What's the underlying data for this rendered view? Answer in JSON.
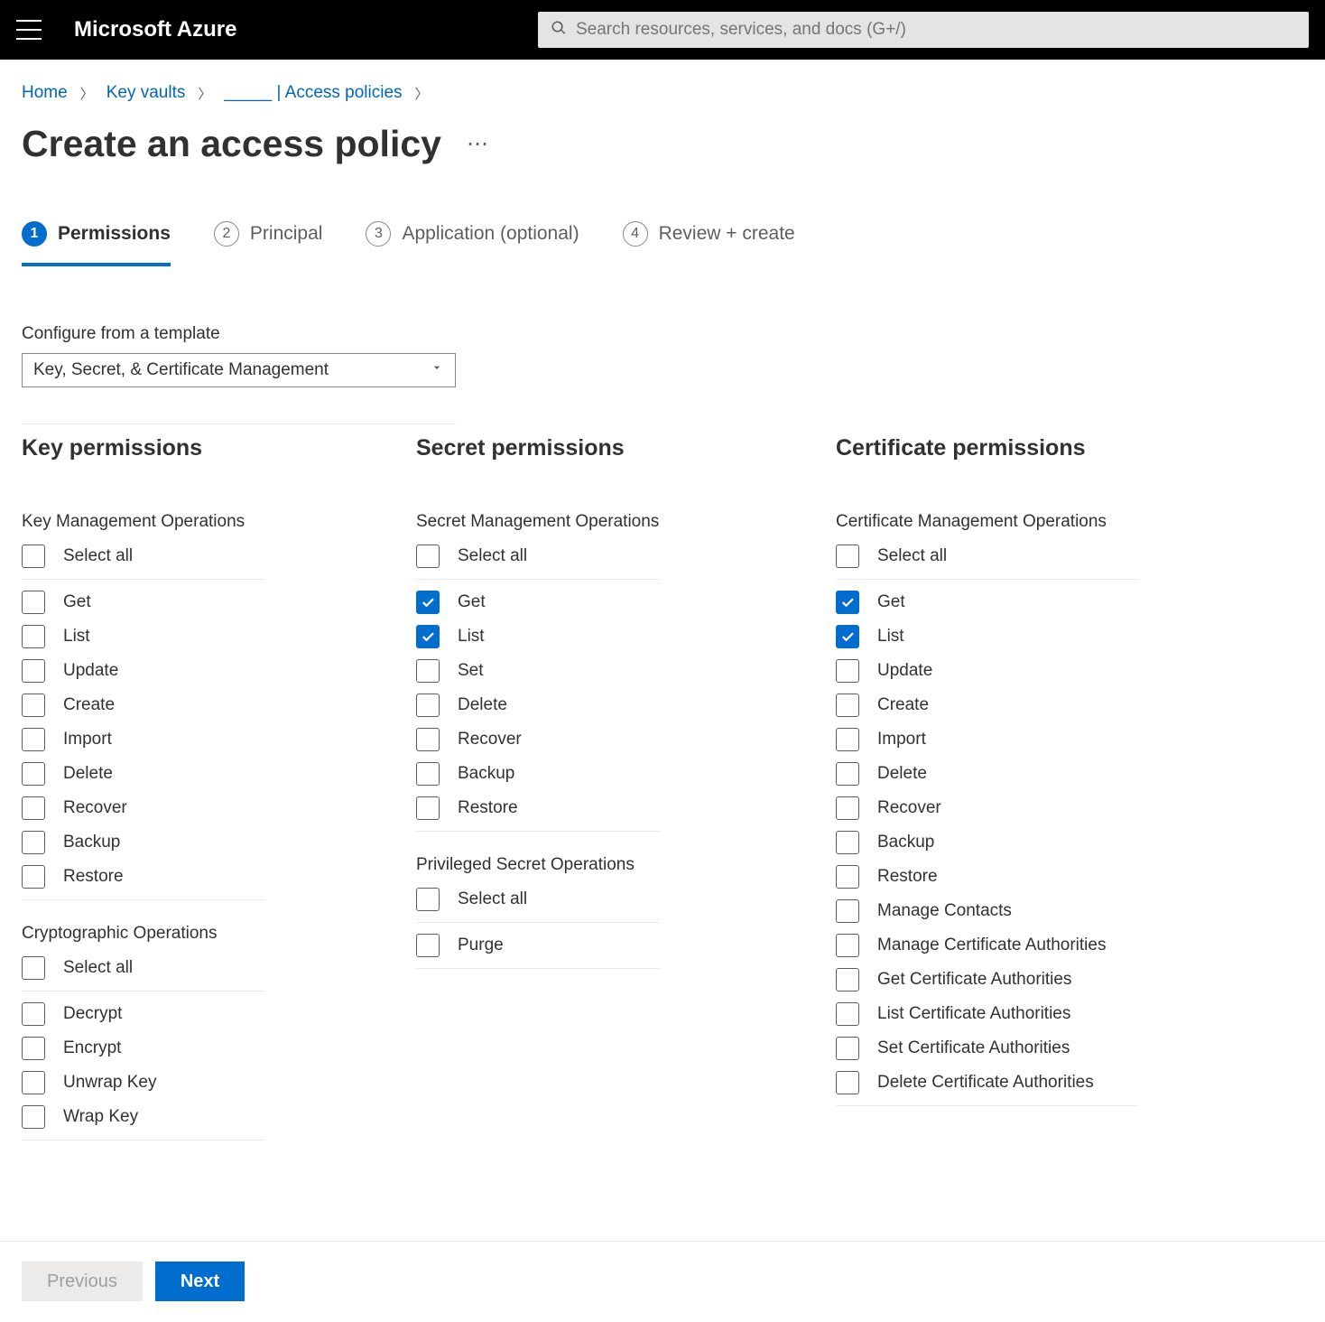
{
  "topbar": {
    "brand": "Microsoft Azure",
    "search_placeholder": "Search resources, services, and docs (G+/)"
  },
  "breadcrumbs": {
    "home": "Home",
    "vaults": "Key vaults",
    "current": "_____ | Access policies"
  },
  "page": {
    "title": "Create an access policy"
  },
  "steps": [
    {
      "num": "1",
      "label": "Permissions",
      "active": true
    },
    {
      "num": "2",
      "label": "Principal",
      "active": false
    },
    {
      "num": "3",
      "label": "Application (optional)",
      "active": false
    },
    {
      "num": "4",
      "label": "Review + create",
      "active": false
    }
  ],
  "template_field": {
    "label": "Configure from a template",
    "value": "Key, Secret, & Certificate Management"
  },
  "columns": {
    "key": {
      "heading": "Key permissions",
      "groups": [
        {
          "name": "Key Management Operations",
          "select_all": "Select all",
          "items": [
            {
              "label": "Get",
              "checked": false
            },
            {
              "label": "List",
              "checked": false
            },
            {
              "label": "Update",
              "checked": false
            },
            {
              "label": "Create",
              "checked": false
            },
            {
              "label": "Import",
              "checked": false
            },
            {
              "label": "Delete",
              "checked": false
            },
            {
              "label": "Recover",
              "checked": false
            },
            {
              "label": "Backup",
              "checked": false
            },
            {
              "label": "Restore",
              "checked": false
            }
          ]
        },
        {
          "name": "Cryptographic Operations",
          "select_all": "Select all",
          "items": [
            {
              "label": "Decrypt",
              "checked": false
            },
            {
              "label": "Encrypt",
              "checked": false
            },
            {
              "label": "Unwrap Key",
              "checked": false
            },
            {
              "label": "Wrap Key",
              "checked": false
            }
          ]
        }
      ]
    },
    "secret": {
      "heading": "Secret permissions",
      "groups": [
        {
          "name": "Secret Management Operations",
          "select_all": "Select all",
          "items": [
            {
              "label": "Get",
              "checked": true
            },
            {
              "label": "List",
              "checked": true
            },
            {
              "label": "Set",
              "checked": false
            },
            {
              "label": "Delete",
              "checked": false
            },
            {
              "label": "Recover",
              "checked": false
            },
            {
              "label": "Backup",
              "checked": false
            },
            {
              "label": "Restore",
              "checked": false
            }
          ]
        },
        {
          "name": "Privileged Secret Operations",
          "select_all": "Select all",
          "items": [
            {
              "label": "Purge",
              "checked": false
            }
          ]
        }
      ]
    },
    "cert": {
      "heading": "Certificate permissions",
      "groups": [
        {
          "name": "Certificate Management Operations",
          "select_all": "Select all",
          "items": [
            {
              "label": "Get",
              "checked": true
            },
            {
              "label": "List",
              "checked": true
            },
            {
              "label": "Update",
              "checked": false
            },
            {
              "label": "Create",
              "checked": false
            },
            {
              "label": "Import",
              "checked": false
            },
            {
              "label": "Delete",
              "checked": false
            },
            {
              "label": "Recover",
              "checked": false
            },
            {
              "label": "Backup",
              "checked": false
            },
            {
              "label": "Restore",
              "checked": false
            },
            {
              "label": "Manage Contacts",
              "checked": false
            },
            {
              "label": "Manage Certificate Authorities",
              "checked": false
            },
            {
              "label": "Get Certificate Authorities",
              "checked": false
            },
            {
              "label": "List Certificate Authorities",
              "checked": false
            },
            {
              "label": "Set Certificate Authorities",
              "checked": false
            },
            {
              "label": "Delete Certificate Authorities",
              "checked": false
            }
          ]
        }
      ]
    }
  },
  "footer": {
    "prev": "Previous",
    "next": "Next"
  }
}
